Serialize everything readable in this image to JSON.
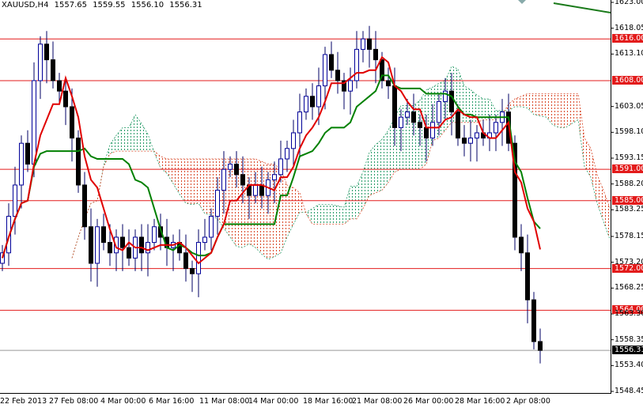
{
  "header": {
    "symbol": "XAUUSD,H4",
    "open": "1557.65",
    "high": "1559.55",
    "low": "1556.10",
    "close": "1556.31"
  },
  "colors": {
    "level": "#e31b1b",
    "tenkan": "#e00000",
    "kijun": "#008000",
    "bull_cloud": "#2a9d6a",
    "bear_cloud": "#d94a2a",
    "candle": "#000066"
  },
  "chart_data": {
    "type": "candlestick",
    "title": "XAUUSD,H4",
    "ylim": [
      1548.45,
      1623.0
    ],
    "yticks": [
      "1623.00",
      "1618.05",
      "1613.10",
      "1603.05",
      "1598.10",
      "1593.15",
      "1588.20",
      "1583.25",
      "1578.15",
      "1573.20",
      "1568.25",
      "1563.30",
      "1558.35",
      "1553.40",
      "1548.45"
    ],
    "xticks": [
      "22 Feb 2013",
      "27 Feb 08:00",
      "4 Mar 00:00",
      "6 Mar 16:00",
      "11 Mar 08:00",
      "14 Mar 00:00",
      "18 Mar 16:00",
      "21 Mar 08:00",
      "26 Mar 00:00",
      "28 Mar 16:00",
      "2 Apr 08:00"
    ],
    "levels": [
      {
        "value": 1616.0,
        "label": "1616.00"
      },
      {
        "value": 1608.0,
        "label": "1608.00"
      },
      {
        "value": 1591.0,
        "label": "1591.00"
      },
      {
        "value": 1585.0,
        "label": "1585.00"
      },
      {
        "value": 1572.0,
        "label": "1572.00"
      },
      {
        "value": 1564.0,
        "label": "1564.00"
      }
    ],
    "current_price": {
      "value": 1556.31,
      "label": "1556.31"
    },
    "closes": [
      1575,
      1582,
      1588,
      1596,
      1592,
      1608,
      1615,
      1612,
      1608,
      1606,
      1603,
      1597,
      1588,
      1580,
      1573,
      1580,
      1577,
      1575,
      1578,
      1576,
      1574,
      1578,
      1575,
      1577,
      1580,
      1578,
      1576,
      1577,
      1575,
      1572,
      1571,
      1577,
      1578,
      1582,
      1587,
      1591,
      1592,
      1590,
      1588,
      1586,
      1588,
      1586,
      1589,
      1590,
      1593,
      1595,
      1598,
      1602,
      1605,
      1603,
      1607,
      1613,
      1610,
      1608,
      1606,
      1608,
      1614,
      1616,
      1614,
      1612,
      1608,
      1607,
      1599,
      1601,
      1602,
      1600,
      1599,
      1597,
      1600,
      1604,
      1606,
      1602,
      1597,
      1596,
      1597,
      1598,
      1597,
      1598,
      1600,
      1602,
      1596,
      1578,
      1575,
      1566,
      1558,
      1556.31
    ],
    "indicators": [
      "Ichimoku Kinko Hyo"
    ]
  }
}
